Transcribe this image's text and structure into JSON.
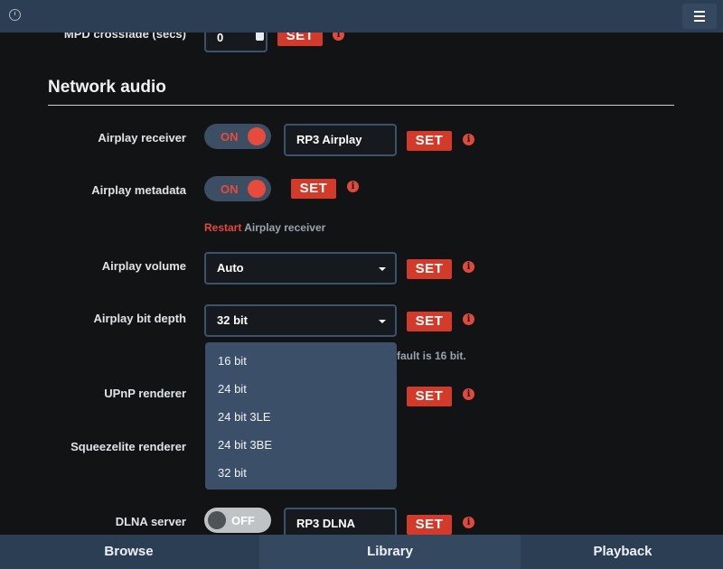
{
  "topbar": {
    "clock_icon": "clock-icon",
    "menu_icon": "hamburger-menu-icon"
  },
  "mpd_crossfade": {
    "label": "MPD crossfade (secs)",
    "value": "0",
    "set_label": "SET"
  },
  "section": {
    "title": "Network audio"
  },
  "airplay_receiver": {
    "label": "Airplay receiver",
    "toggle": "ON",
    "name": "RP3 Airplay",
    "set_label": "SET"
  },
  "airplay_metadata": {
    "label": "Airplay metadata",
    "toggle": "ON",
    "set_label": "SET"
  },
  "restart_hint": {
    "link": "Restart",
    "text": " Airplay receiver"
  },
  "airplay_volume": {
    "label": "Airplay volume",
    "value": "Auto",
    "set_label": "SET"
  },
  "airplay_bit_depth": {
    "label": "Airplay bit depth",
    "value": "32 bit",
    "set_label": "SET",
    "hint": "fault is 16 bit.",
    "options": [
      "16 bit",
      "24 bit",
      "24 bit 3LE",
      "24 bit 3BE",
      "32 bit"
    ]
  },
  "upnp_renderer": {
    "label": "UPnP renderer",
    "set_label": "SET"
  },
  "squeezelite_renderer": {
    "label": "Squeezelite renderer"
  },
  "dlna_server": {
    "label": "DLNA server",
    "toggle": "OFF",
    "name": "RP3 DLNA",
    "set_label": "SET"
  },
  "info_glyph": "i",
  "nav": {
    "tabs": [
      "Browse",
      "Library",
      "Playback"
    ]
  },
  "colors": {
    "accent": "#e14a3a",
    "topbar": "#2c3e54",
    "background": "#121315",
    "dropdown": "#3b5068"
  }
}
